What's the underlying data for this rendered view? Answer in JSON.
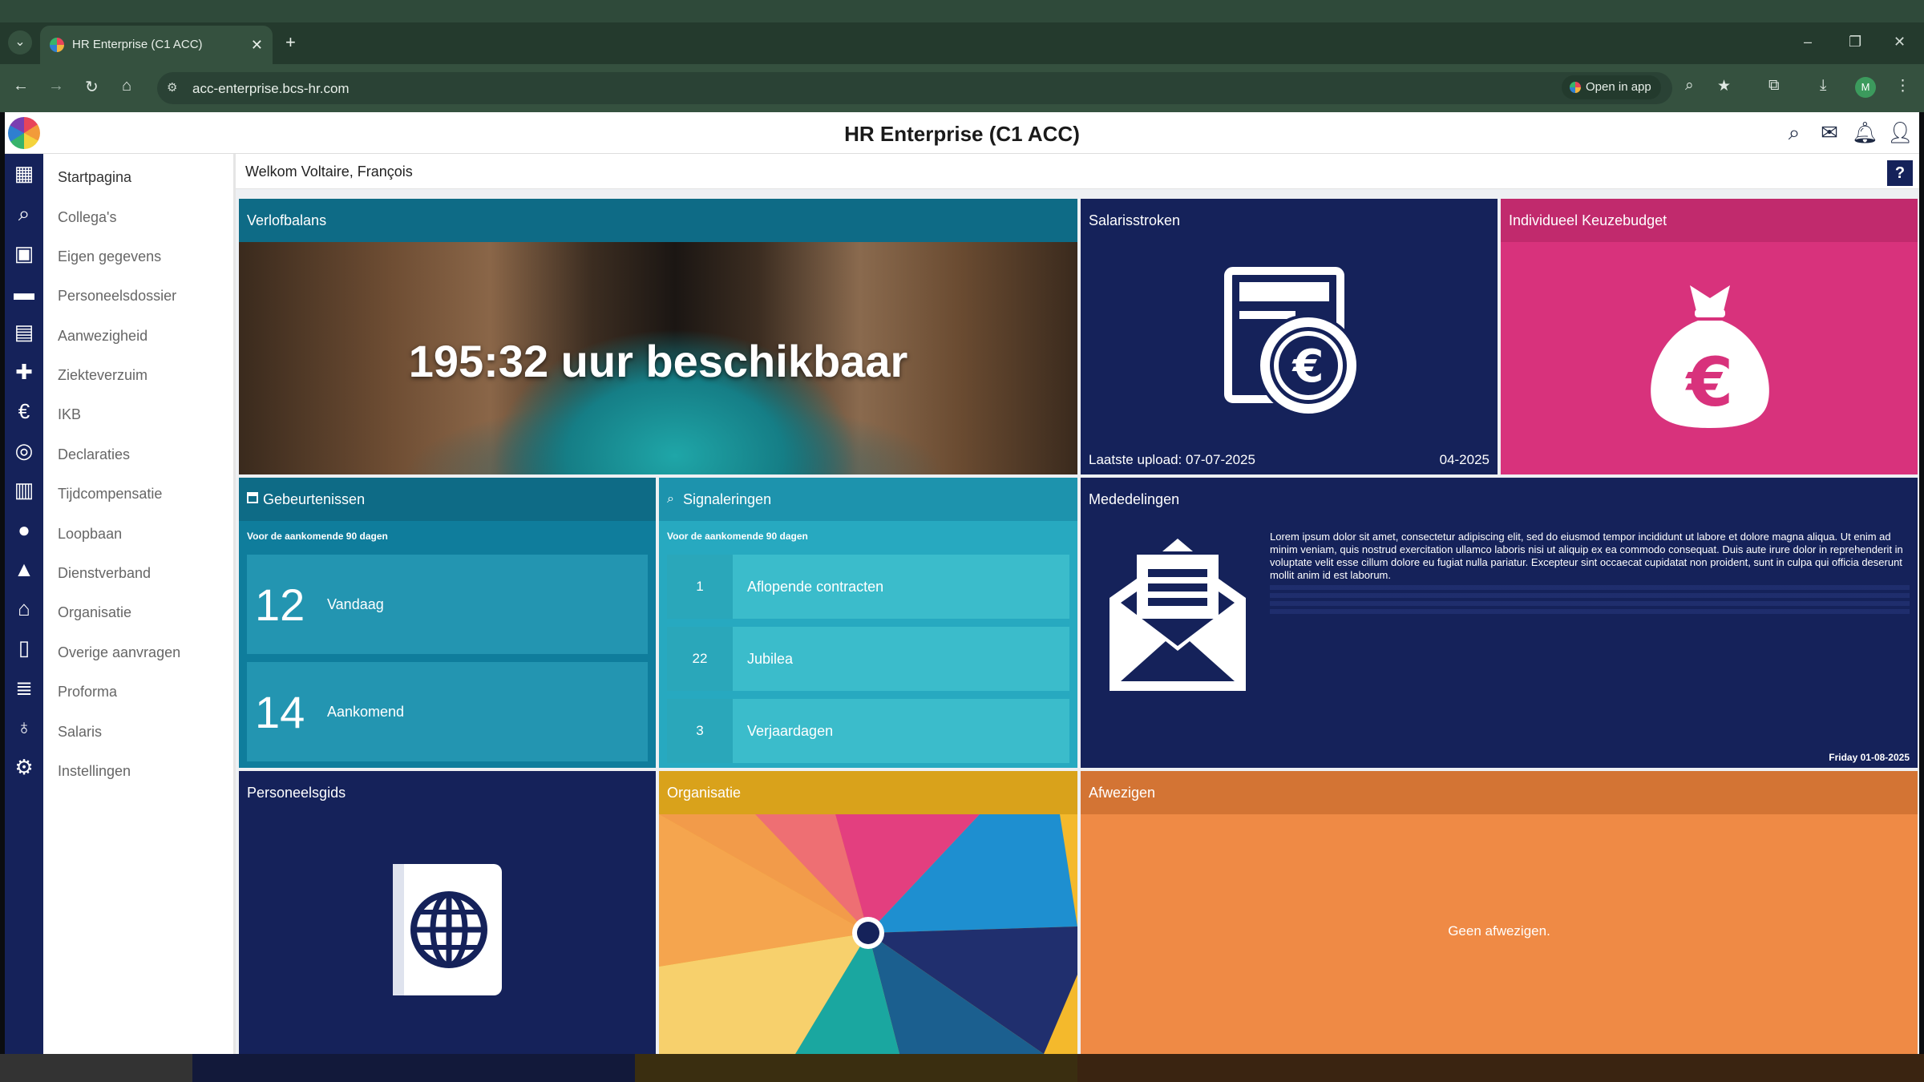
{
  "browser": {
    "tab_title": "HR Enterprise (C1 ACC)",
    "url": "acc-enterprise.bcs-hr.com",
    "open_in_app": "Open in app",
    "profile_initial": "M"
  },
  "app": {
    "title": "HR Enterprise (C1 ACC)",
    "welcome": "Welkom Voltaire, François",
    "help": "?"
  },
  "sidebar": {
    "items": [
      {
        "label": "Startpagina",
        "icon": "grid-icon"
      },
      {
        "label": "Collega's",
        "icon": "search-people-icon"
      },
      {
        "label": "Eigen gegevens",
        "icon": "id-card-icon"
      },
      {
        "label": "Personeelsdossier",
        "icon": "folder-icon"
      },
      {
        "label": "Aanwezigheid",
        "icon": "calendar-icon"
      },
      {
        "label": "Ziekteverzuim",
        "icon": "medical-kit-icon"
      },
      {
        "label": "IKB",
        "icon": "money-bag-icon"
      },
      {
        "label": "Declaraties",
        "icon": "coin-hand-icon"
      },
      {
        "label": "Tijdcompensatie",
        "icon": "calendar-clock-icon"
      },
      {
        "label": "Loopbaan",
        "icon": "person-icon"
      },
      {
        "label": "Dienstverband",
        "icon": "badge-person-icon"
      },
      {
        "label": "Organisatie",
        "icon": "building-icon"
      },
      {
        "label": "Overige aanvragen",
        "icon": "document-icon"
      },
      {
        "label": "Proforma",
        "icon": "document-list-icon"
      },
      {
        "label": "Salaris",
        "icon": "salary-hand-icon"
      },
      {
        "label": "Instellingen",
        "icon": "gear-icon"
      }
    ]
  },
  "tiles": {
    "verlof": {
      "title": "Verlofbalans",
      "value": "195:32 uur beschikbaar"
    },
    "salaris": {
      "title": "Salarisstroken",
      "last_upload": "Laatste upload: 07-07-2025",
      "period": "04-2025"
    },
    "ikb": {
      "title": "Individueel Keuzebudget"
    },
    "gebeurtenissen": {
      "title": "Gebeurtenissen",
      "sub": "Voor de aankomende 90 dagen",
      "rows": [
        {
          "count": "12",
          "label": "Vandaag"
        },
        {
          "count": "14",
          "label": "Aankomend"
        }
      ]
    },
    "signaleringen": {
      "title": "Signaleringen",
      "sub": "Voor de aankomende 90 dagen",
      "rows": [
        {
          "count": "1",
          "label": "Aflopende contracten"
        },
        {
          "count": "22",
          "label": "Jubilea"
        },
        {
          "count": "3",
          "label": "Verjaardagen"
        }
      ]
    },
    "mededelingen": {
      "title": "Mededelingen",
      "text": "Lorem ipsum dolor sit amet, consectetur adipiscing elit, sed do eiusmod tempor incididunt ut labore et dolore magna aliqua. Ut enim ad minim veniam, quis nostrud exercitation ullamco laboris nisi ut aliquip ex ea commodo consequat. Duis aute irure dolor in reprehenderit in voluptate velit esse cillum dolore eu fugiat nulla pariatur. Excepteur sint occaecat cupidatat non proident, sunt in culpa qui officia deserunt mollit anim id est laborum.",
      "date": "Friday 01-08-2025"
    },
    "personeelsgids": {
      "title": "Personeelsgids"
    },
    "organisatie": {
      "title": "Organisatie"
    },
    "afwezigen": {
      "title": "Afwezigen",
      "empty": "Geen afwezigen."
    }
  },
  "colors": {
    "navy": "#15225a",
    "teal_header": "#0e6b86",
    "teal_light": "#27a0b8",
    "teal_bright": "#34b3c4",
    "pink": "#d8327c",
    "gold": "#d9a21b",
    "orange": "#ef8a45",
    "orange_header": "#d37434"
  }
}
